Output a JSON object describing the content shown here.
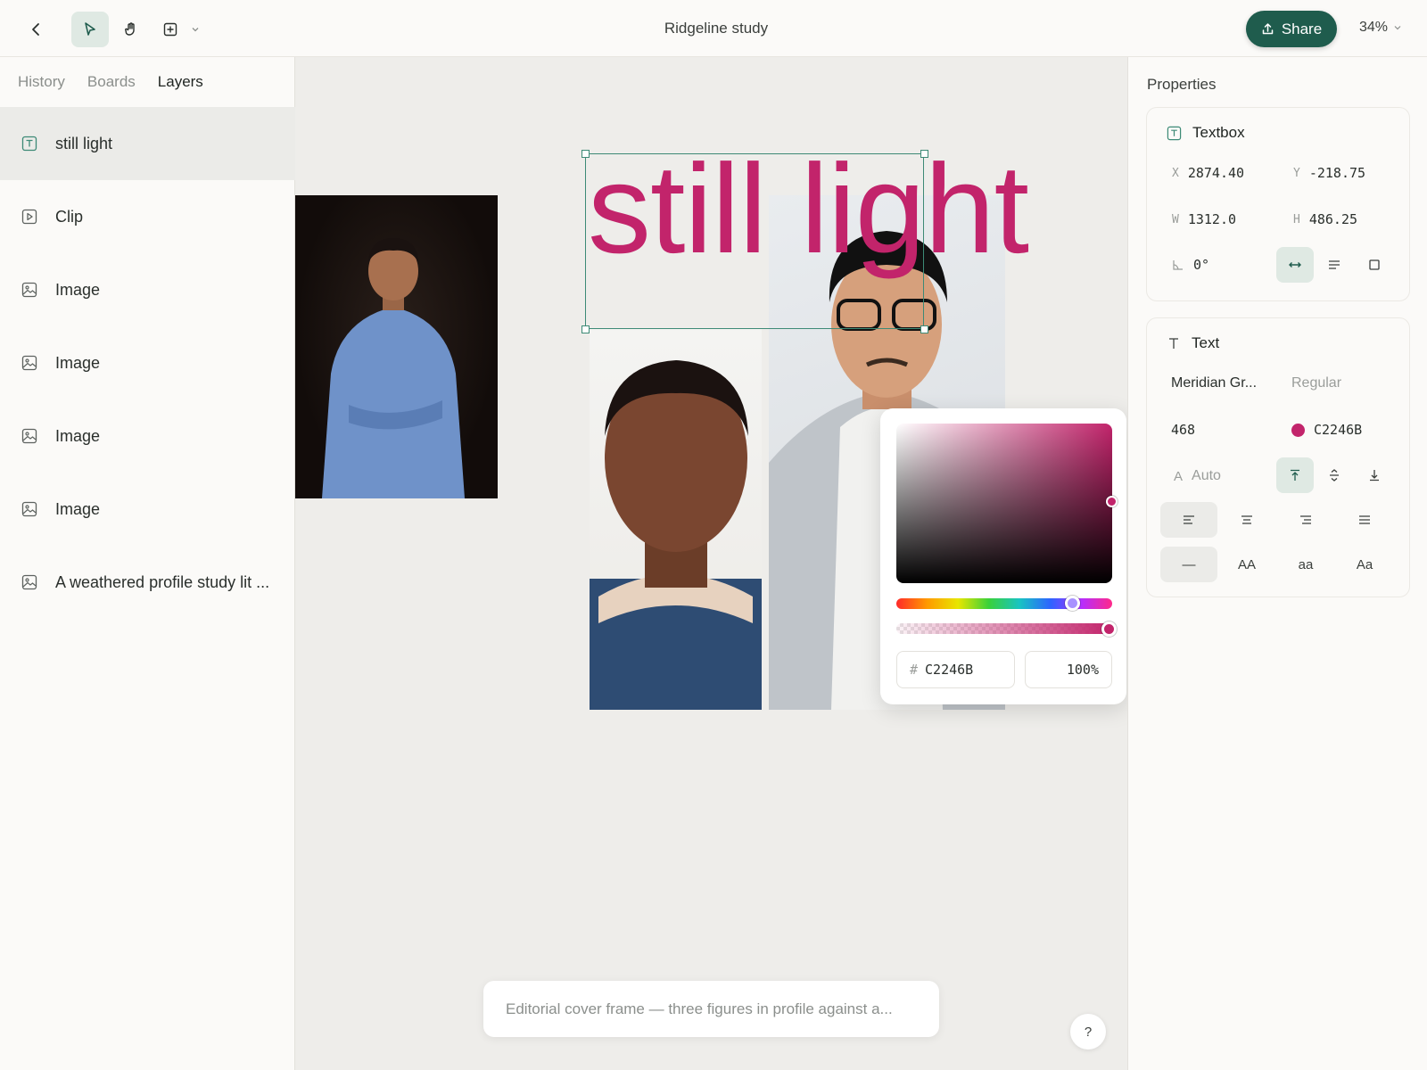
{
  "topbar": {
    "title": "Ridgeline study",
    "share_label": "Share",
    "zoom": "34%"
  },
  "left_panel": {
    "tabs": [
      {
        "label": "History",
        "active": false
      },
      {
        "label": "Boards",
        "active": false
      },
      {
        "label": "Layers",
        "active": true
      }
    ],
    "layers": [
      {
        "label": "still light",
        "icon": "textbox-icon",
        "selected": true
      },
      {
        "label": "Clip",
        "icon": "video-icon",
        "selected": false
      },
      {
        "label": "Image",
        "icon": "image-icon",
        "selected": false
      },
      {
        "label": "Image",
        "icon": "image-icon",
        "selected": false
      },
      {
        "label": "Image",
        "icon": "image-icon",
        "selected": false
      },
      {
        "label": "Image",
        "icon": "image-icon",
        "selected": false
      },
      {
        "label": "A weathered profile study lit ...",
        "icon": "image-icon",
        "selected": false
      }
    ]
  },
  "canvas": {
    "headline": "still light",
    "headline_color": "#c2246b",
    "prompt_text": "Editorial cover frame — three figures in profile against a...",
    "help_label": "?"
  },
  "color_picker": {
    "hash": "#",
    "hex": "C2246B",
    "opacity": "100%"
  },
  "properties": {
    "title": "Properties",
    "textbox": {
      "title": "Textbox",
      "x_label": "X",
      "x": "2874.40",
      "y_label": "Y",
      "y": "-218.75",
      "w_label": "W",
      "w": "1312.0",
      "h_label": "H",
      "h": "486.25",
      "rotation": "0°"
    },
    "text": {
      "title": "Text",
      "font_family": "Meridian Gr...",
      "font_weight": "Regular",
      "font_size": "468",
      "color_hex": "C2246B",
      "line_height_label": "A",
      "line_height": "Auto",
      "case_none": "—",
      "case_upper": "AA",
      "case_lower": "aa",
      "case_title": "Aa"
    }
  },
  "colors": {
    "accent": "#1f5c4d",
    "brand_text": "#c2246b",
    "selection": "#3d8a76"
  }
}
